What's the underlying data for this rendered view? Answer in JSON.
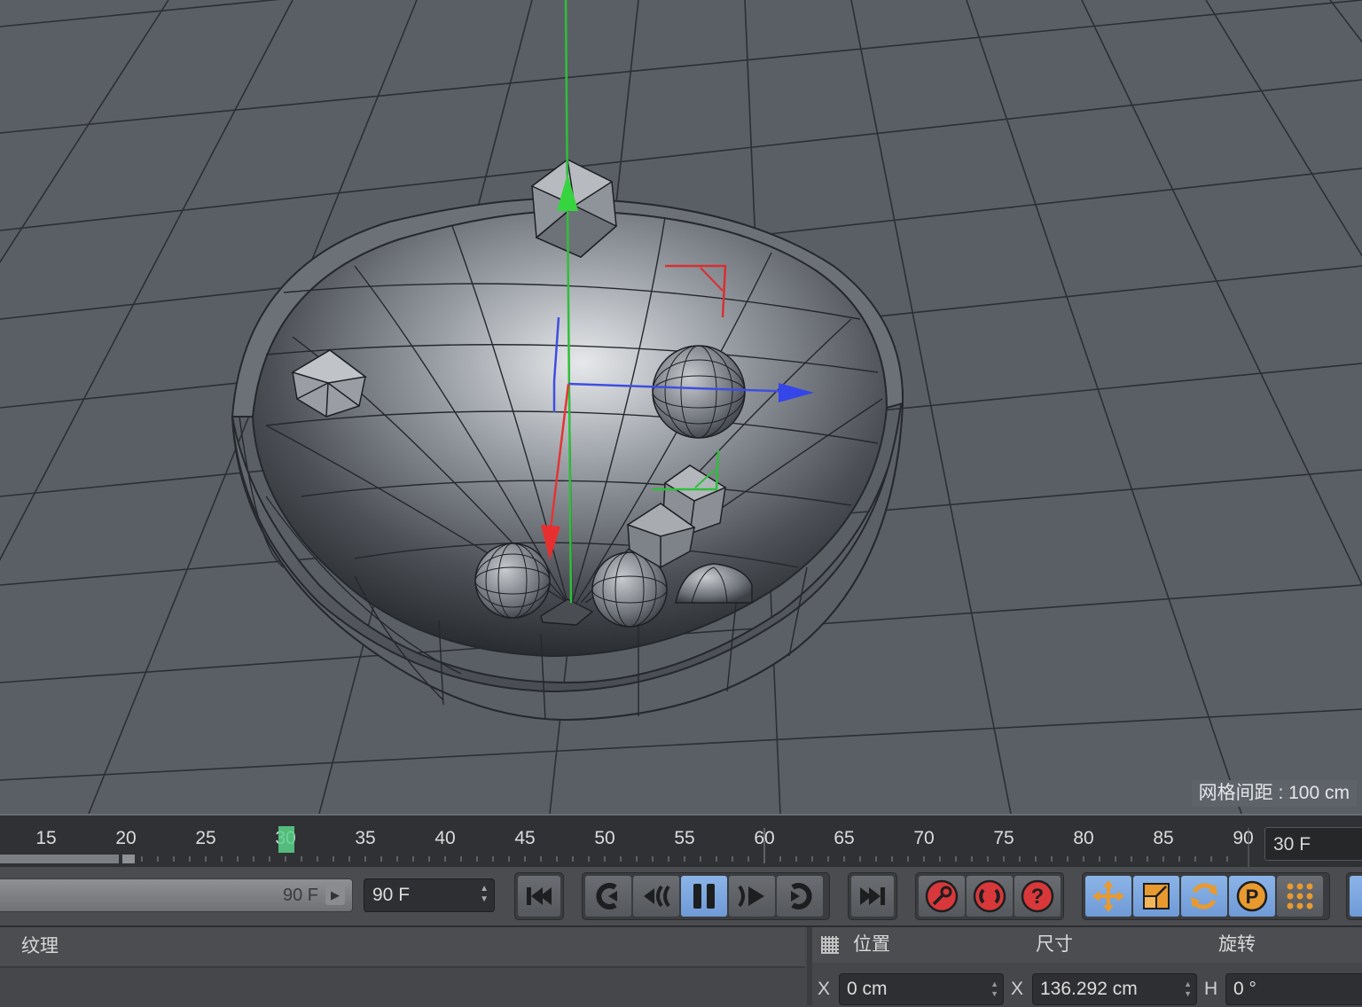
{
  "viewport": {
    "grid_spacing_label": "网格间距 : 100 cm"
  },
  "timeline": {
    "ticks": [
      "15",
      "20",
      "25",
      "30",
      "35",
      "40",
      "45",
      "50",
      "55",
      "60",
      "65",
      "70",
      "75",
      "80",
      "85",
      "90"
    ],
    "current_frame": "30 F"
  },
  "transport": {
    "range_end": "90 F",
    "max_frame": "90 F",
    "buttons": {
      "go_start": "go-to-start-icon",
      "prev_key": "previous-keyframe-icon",
      "prev_frame": "previous-frame-icon",
      "pause": "pause-icon",
      "next_frame": "next-frame-icon",
      "next_key": "next-keyframe-icon",
      "go_end": "go-to-end-icon",
      "record": "record-keys-icon",
      "auto_key": "autokeying-icon",
      "key_selection": "keyframe-selection-icon",
      "key_position": "position-key-icon",
      "key_scale": "scale-key-icon",
      "key_rotation": "rotation-key-icon",
      "key_parameter": "parameter-key-icon",
      "key_pla": "point-level-animation-icon"
    },
    "active_state_color": "#7fa9e2",
    "record_color": "#e0373a"
  },
  "panels": {
    "materials_title": "纹理",
    "coords": {
      "position": "位置",
      "size": "尺寸",
      "rotation": "旋转",
      "x_label": "X",
      "size_x_label": "X",
      "h_label": "H",
      "position_x": "0 cm",
      "size_x": "136.292 cm",
      "rotation_h": "0 °"
    }
  }
}
